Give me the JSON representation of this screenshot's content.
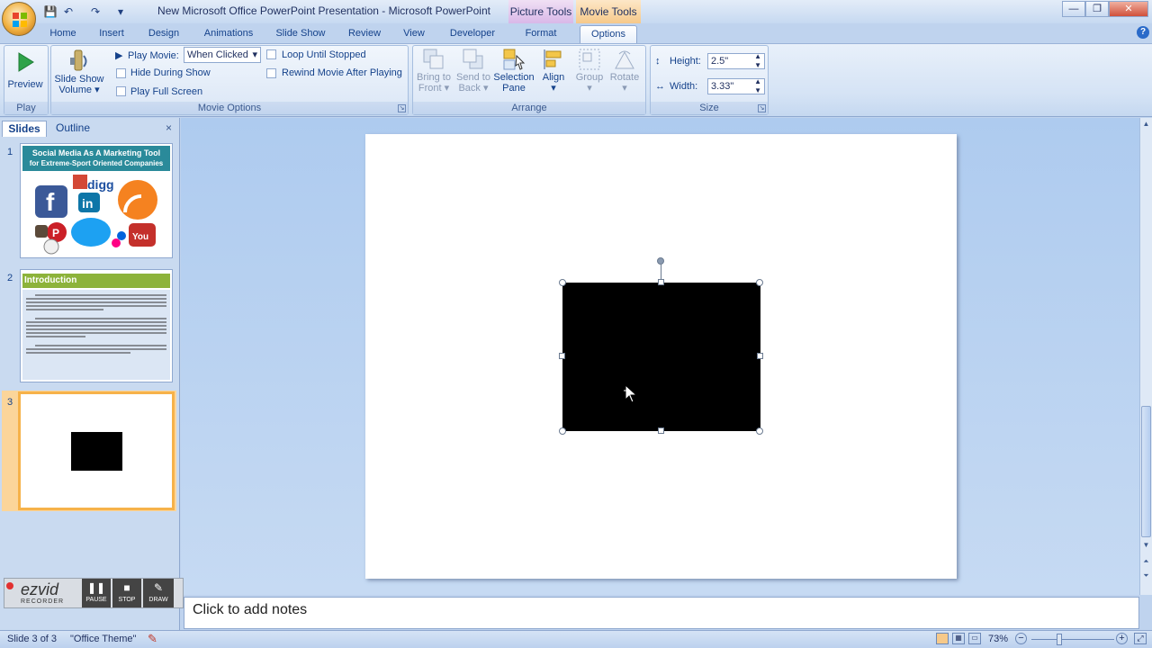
{
  "window": {
    "title": "New Microsoft Office PowerPoint Presentation - Microsoft PowerPoint",
    "context_picture": "Picture Tools",
    "context_movie": "Movie Tools",
    "min": "—",
    "max": "❐",
    "close": "✕"
  },
  "qat": {
    "save": "💾",
    "undo": "↶",
    "redo": "↷",
    "more": "▾"
  },
  "tabs": [
    "Home",
    "Insert",
    "Design",
    "Animations",
    "Slide Show",
    "Review",
    "View",
    "Developer",
    "Format",
    "Options"
  ],
  "ribbon": {
    "play": {
      "preview": "Preview",
      "label": "Play"
    },
    "movie_options": {
      "volume_line1": "Slide Show",
      "volume_line2": "Volume",
      "play_movie_label": "Play Movie:",
      "play_movie_value": "When Clicked",
      "hide_during_show": "Hide During Show",
      "play_full_screen": "Play Full Screen",
      "loop_until_stopped": "Loop Until Stopped",
      "rewind": "Rewind Movie After Playing",
      "label": "Movie Options"
    },
    "arrange": {
      "bring_front_1": "Bring to",
      "bring_front_2": "Front",
      "send_back_1": "Send to",
      "send_back_2": "Back",
      "selection_1": "Selection",
      "selection_2": "Pane",
      "align": "Align",
      "group": "Group",
      "rotate": "Rotate",
      "label": "Arrange"
    },
    "size": {
      "height_label": "Height:",
      "height_value": "2.5\"",
      "width_label": "Width:",
      "width_value": "3.33\"",
      "label": "Size"
    }
  },
  "pane": {
    "tab_slides": "Slides",
    "tab_outline": "Outline",
    "close": "×",
    "slides": [
      {
        "num": "1",
        "title_line1": "Social Media As A Marketing Tool",
        "title_line2": "for Extreme-Sport Oriented Companies"
      },
      {
        "num": "2",
        "title": "Introduction"
      },
      {
        "num": "3"
      }
    ]
  },
  "recorder": {
    "brand": "ezvid",
    "sub": "RECORDER",
    "pause": "PAUSE",
    "stop": "STOP",
    "draw": "DRAW"
  },
  "notes": {
    "placeholder": "Click to add notes"
  },
  "status": {
    "slide": "Slide 3 of 3",
    "theme": "\"Office Theme\"",
    "zoom": "73%"
  }
}
